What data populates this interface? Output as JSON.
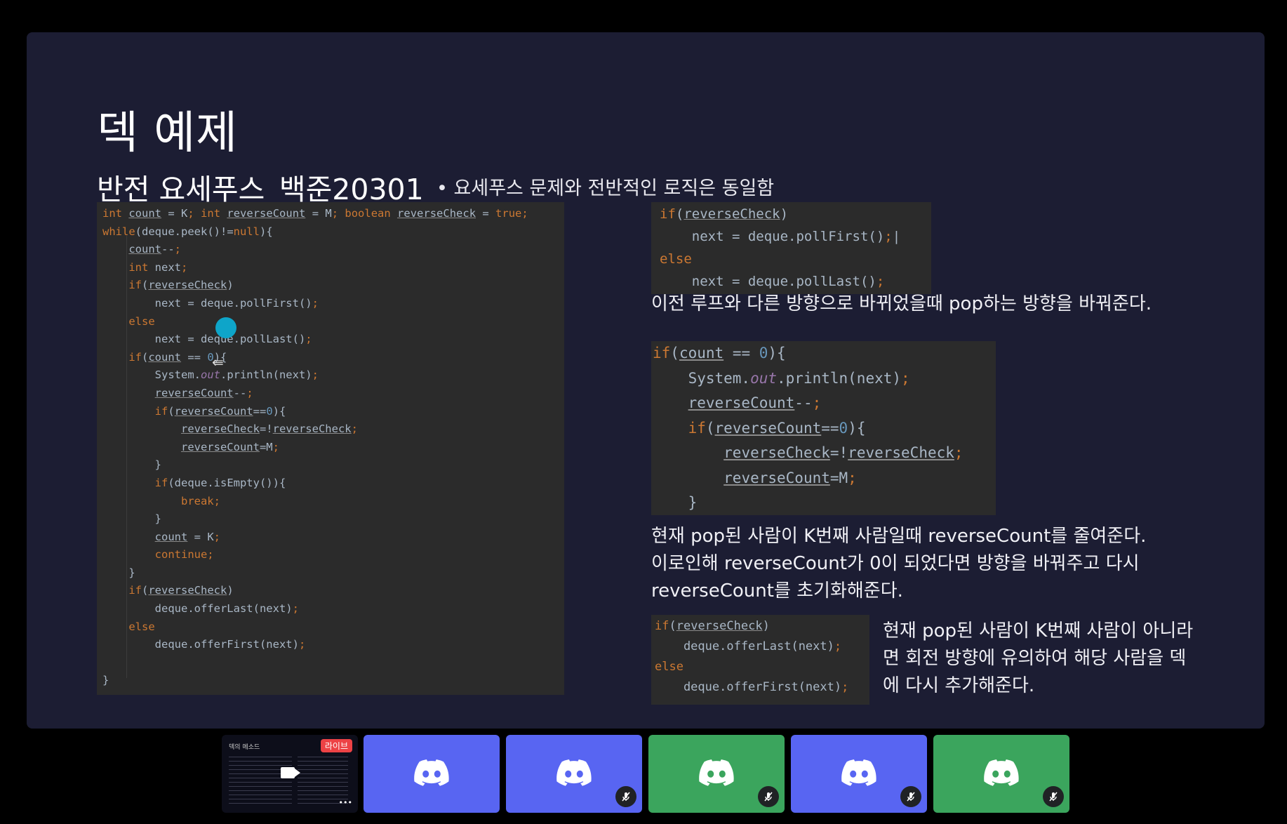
{
  "slide": {
    "title": "덱 예제",
    "subtitle": "반전 요세푸스_백준20301",
    "bullet": "• 요세푸스 문제와 전반적인 로직은 동일함"
  },
  "descriptions": {
    "d1": "이전 루프와 다른 방향으로 바뀌었을때 pop하는 방향을 바꿔준다.",
    "d2_l1": "현재 pop된 사람이 K번째 사람일때 reverseCount를 줄여준다.",
    "d2_l2": "이로인해 reverseCount가 0이 되었다면 방향을 바꿔주고 다시",
    "d2_l3": "reverseCount를 초기화해준다.",
    "d3_l1": "현재 pop된 사람이 K번째 사람이 아니라",
    "d3_l2": "면 회전 방향에 유의하여 해당 사람을 덱",
    "d3_l3": "에 다시 추가해준다."
  },
  "call": {
    "thumbnail_badge": "라이브",
    "thumbnail_title": "덱의 메소드",
    "more_label": "•••",
    "participants": [
      {
        "color": "#5865f2",
        "muted": false
      },
      {
        "color": "#5865f2",
        "muted": true
      },
      {
        "color": "#3ba55d",
        "muted": true
      },
      {
        "color": "#5865f2",
        "muted": true
      },
      {
        "color": "#3ba55d",
        "muted": true
      }
    ]
  }
}
